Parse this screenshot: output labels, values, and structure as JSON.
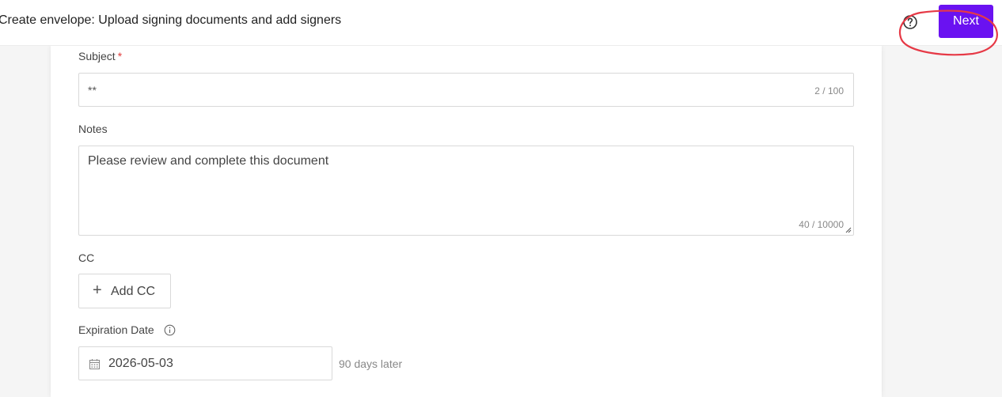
{
  "header": {
    "title": "Create envelope: Upload signing documents and add signers",
    "help_icon": "question-circle-icon",
    "next_label": "Next",
    "accent_color": "#6a12f1",
    "annotation_color": "#e63946"
  },
  "form": {
    "subject": {
      "label": "Subject",
      "required_mark": "*",
      "value": "**",
      "counter": "2 / 100"
    },
    "notes": {
      "label": "Notes",
      "value": "Please review and complete this document",
      "counter": "40 / 10000"
    },
    "cc": {
      "label": "CC",
      "add_label": "Add CC",
      "add_icon": "plus-icon"
    },
    "expiration": {
      "label": "Expiration Date",
      "info_icon": "info-circle-icon",
      "calendar_icon": "calendar-icon",
      "value": "2026-05-03",
      "hint": "90 days later"
    }
  }
}
